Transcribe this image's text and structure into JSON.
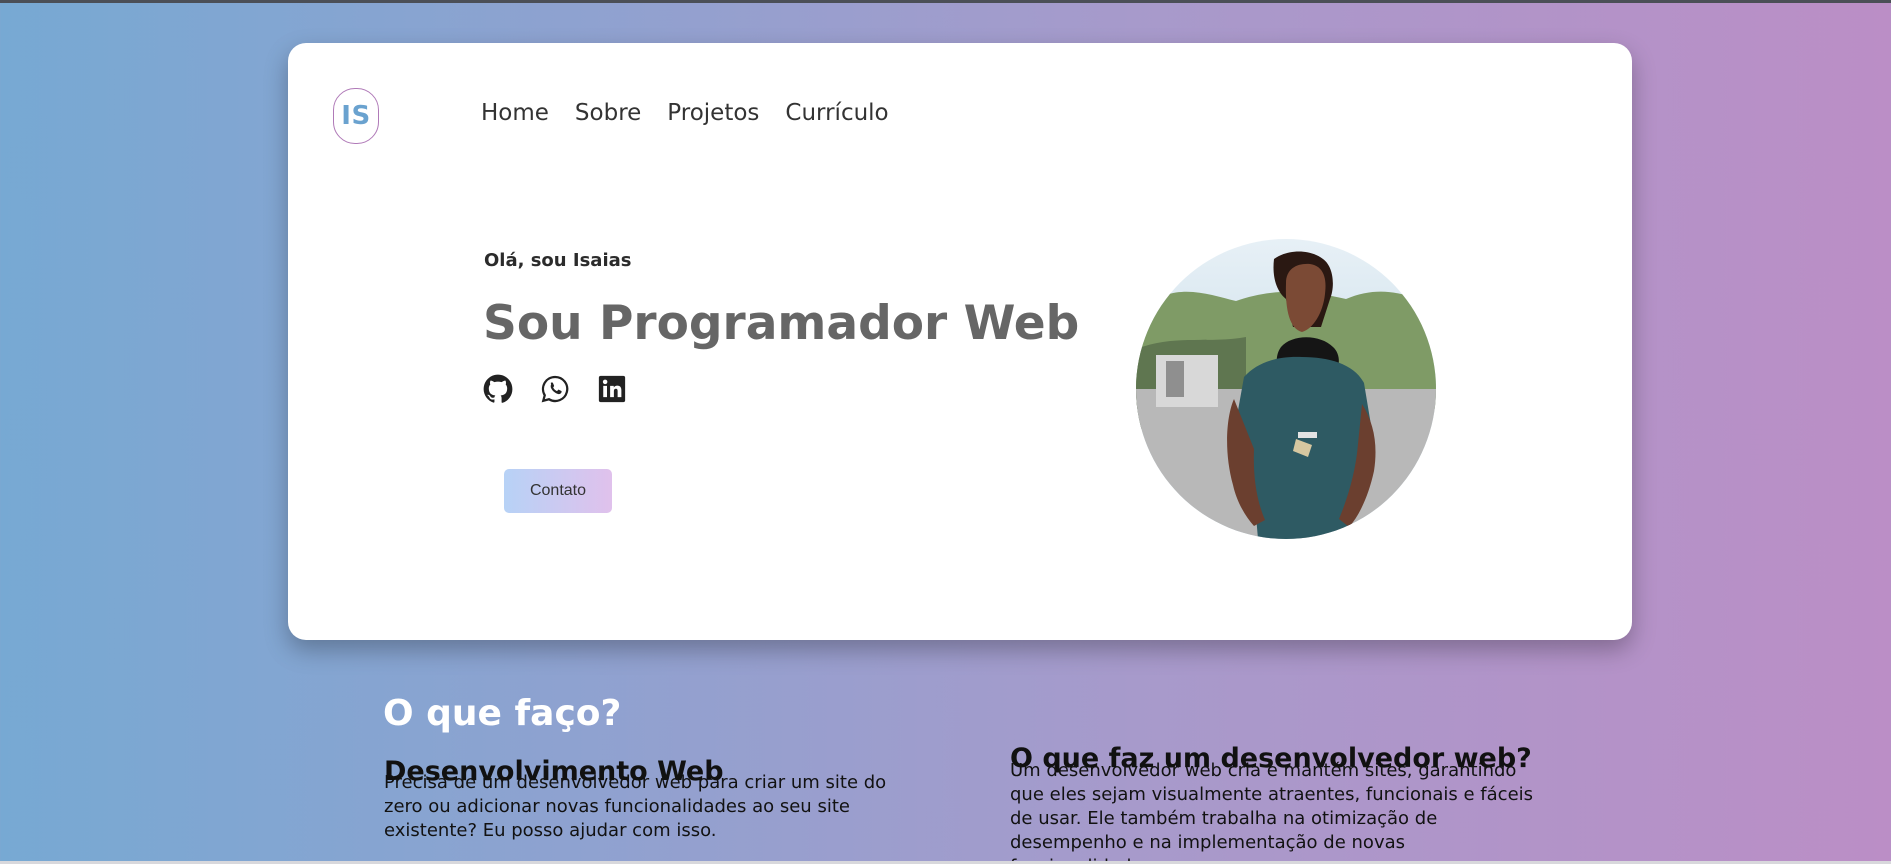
{
  "colors": {
    "gradient_left": "#77a9d3",
    "gradient_right": "#bb8ec6",
    "logo_text": "#6aa2cf",
    "logo_border": "#b07ab8",
    "headline": "#666666",
    "button_start": "#b7d2f6",
    "button_end": "#e0c1ec"
  },
  "header": {
    "logo_text": "IS",
    "nav": [
      {
        "label": "Home"
      },
      {
        "label": "Sobre"
      },
      {
        "label": "Projetos"
      },
      {
        "label": "Currículo"
      }
    ]
  },
  "hero": {
    "greeting": "Olá, sou Isaias",
    "headline": "Sou Programador Web",
    "socials": [
      {
        "icon": "github-icon"
      },
      {
        "icon": "whatsapp-icon"
      },
      {
        "icon": "linkedin-icon"
      }
    ],
    "contact_label": "Contato",
    "avatar_icon": "profile-photo"
  },
  "services": {
    "title": "O que faço?",
    "cards": [
      {
        "title": "Desenvolvimento Web",
        "text": "Precisa de um desenvolvedor web para criar um site do zero ou adicionar novas funcionalidades ao seu site existente? Eu posso ajudar com isso."
      },
      {
        "title": "O que faz um desenvolvedor web?",
        "text": "Um desenvolvedor web cria e mantém sites, garantindo que eles sejam visualmente atraentes, funcionais e fáceis de usar. Ele também trabalha na otimização de desempenho e na implementação de novas funcionalidades."
      }
    ]
  }
}
